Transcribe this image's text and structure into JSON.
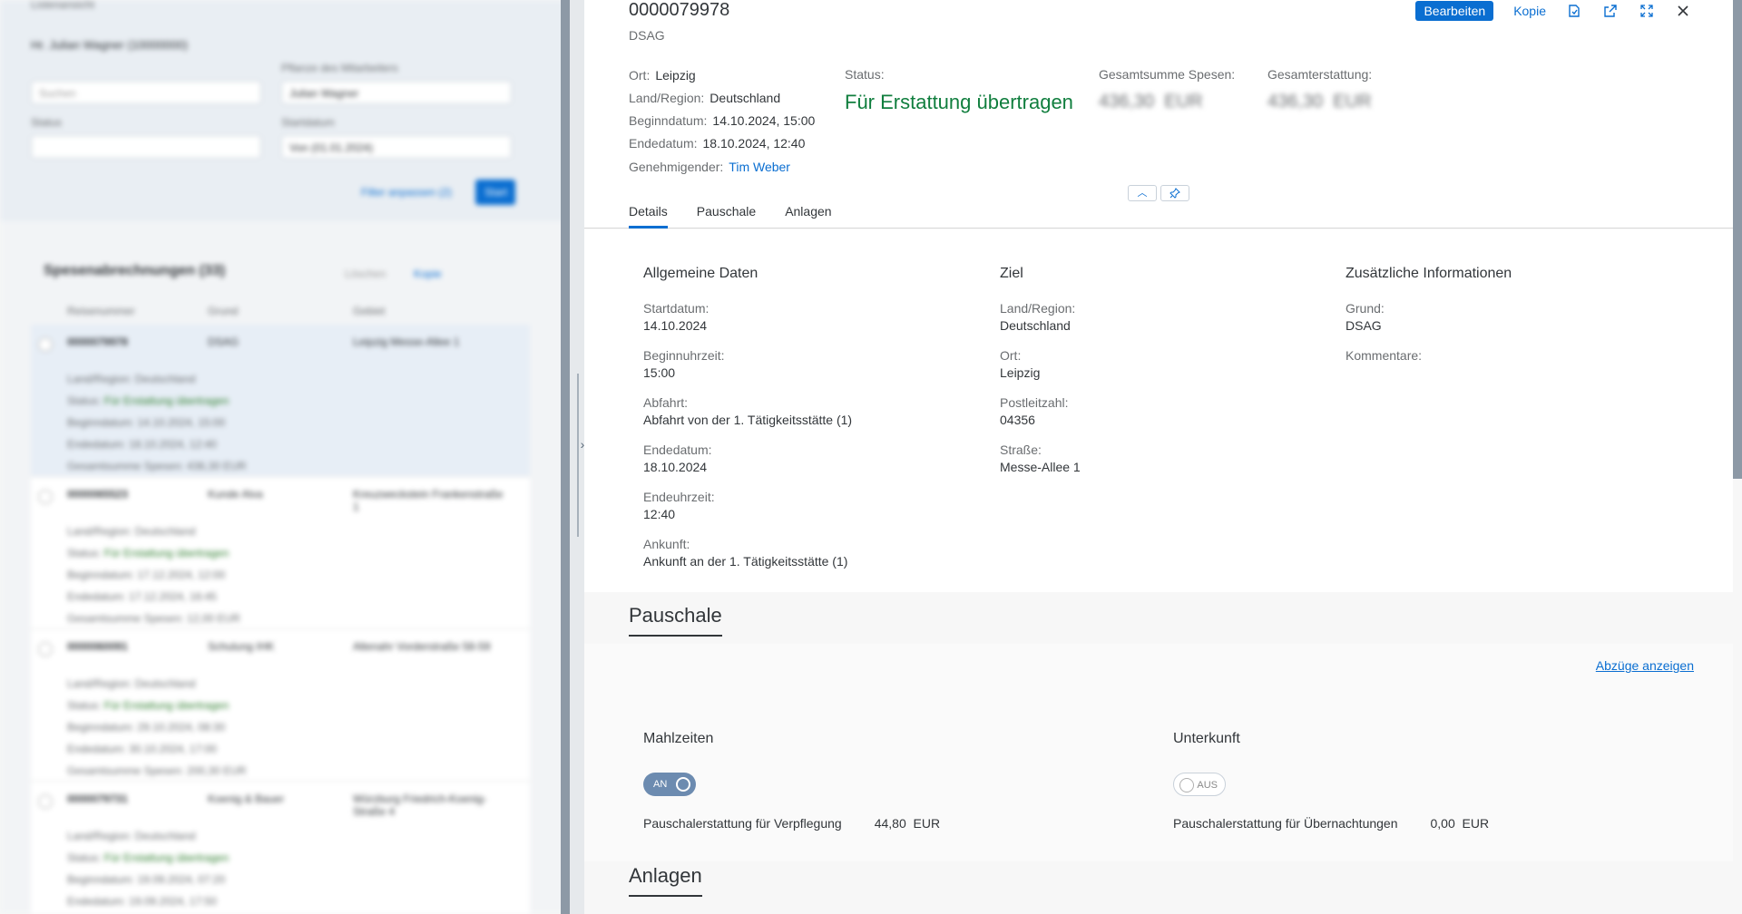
{
  "master": {
    "tag": "Listenansicht",
    "header": "Hr. Julian Wagner (10000000)",
    "search_placeholder": "Suchen",
    "filter1_label": "Pflanze des Mitarbeiters",
    "filter1_value": "Julian Wagner",
    "filter2_label": "Status",
    "filter3_label": "Startdatum",
    "filter3_value": "Von (01.01.2024)",
    "filter_show_btn": "Filter anpassen (2)",
    "go_btn": "Start",
    "list_title": "Spesenabrechnungen (33)",
    "list_action1": "Löschen",
    "list_action2": "Kopie",
    "col_headers": [
      "Reisenummer",
      "Grund",
      "Gebiet"
    ],
    "rows": [
      {
        "id": "0000079978",
        "grund": "DSAG",
        "gebiet": "Leipzig Messe-Allee 1",
        "land": "Land/Region: Deutschland",
        "status_lbl": "Status:",
        "status": "Für Erstattung übertragen",
        "begin": "Beginndatum: 14.10.2024, 15:00",
        "end": "Endedatum: 18.10.2024, 12:40",
        "sum": "Gesamtsumme Spesen: 436,30 EUR"
      },
      {
        "id": "0000065523",
        "grund": "Kunde Alva",
        "gebiet": "Kreuzweckstein Frankenstraße 1",
        "land": "Land/Region: Deutschland",
        "status_lbl": "Status:",
        "status": "Für Erstattung übertragen",
        "begin": "Beginndatum: 17.12.2024, 12:00",
        "end": "Endedatum: 17.12.2024, 16:45",
        "sum": "Gesamtsumme Spesen: 12,00 EUR"
      },
      {
        "id": "0000060091",
        "grund": "Schulung IHK",
        "gebiet": "Altenahr Vorderstraße 58-59",
        "land": "Land/Region: Deutschland",
        "status_lbl": "Status:",
        "status": "Für Erstattung übertragen",
        "begin": "Beginndatum: 29.10.2024, 08:30",
        "end": "Endedatum: 30.10.2024, 17:00",
        "sum": "Gesamtsumme Spesen: 200,30 EUR"
      },
      {
        "id": "0000079731",
        "grund": "Koenig & Bauer",
        "gebiet": "Würzburg Friedrich-Koenig-Straße 4",
        "land": "Land/Region: Deutschland",
        "status_lbl": "Status:",
        "status": "Für Erstattung übertragen",
        "begin": "Beginndatum: 19.09.2024, 07:20",
        "end": "Endedatum: 19.09.2024, 17:50",
        "sum": ""
      }
    ]
  },
  "header": {
    "title": "0000079978",
    "subtitle": "DSAG",
    "ort_lbl": "Ort:",
    "ort": "Leipzig",
    "land_lbl": "Land/Region:",
    "land": "Deutschland",
    "begin_lbl": "Beginndatum:",
    "begin": "14.10.2024, 15:00",
    "end_lbl": "Endedatum:",
    "end": "18.10.2024, 12:40",
    "approver_lbl": "Genehmigender:",
    "approver": "Tim Weber",
    "status_lbl": "Status:",
    "status": "Für Erstattung übertragen",
    "sum_lbl": "Gesamtsumme Spesen:",
    "sum_val": "436,30",
    "sum_cur": "EUR",
    "refund_lbl": "Gesamterstattung:",
    "refund_val": "436,30",
    "refund_cur": "EUR",
    "edit_btn": "Bearbeiten",
    "copy_btn": "Kopie"
  },
  "tabs": [
    "Details",
    "Pauschale",
    "Anlagen"
  ],
  "details": {
    "col1_title": "Allgemeine Daten",
    "col1": [
      {
        "label": "Startdatum:",
        "value": "14.10.2024"
      },
      {
        "label": "Beginnuhrzeit:",
        "value": "15:00"
      },
      {
        "label": "Abfahrt:",
        "value": "Abfahrt von der 1. Tätigkeitsstätte (1)"
      },
      {
        "label": "Endedatum:",
        "value": "18.10.2024"
      },
      {
        "label": "Endeuhrzeit:",
        "value": "12:40"
      },
      {
        "label": "Ankunft:",
        "value": "Ankunft an der 1. Tätigkeitsstätte (1)"
      }
    ],
    "col2_title": "Ziel",
    "col2": [
      {
        "label": "Land/Region:",
        "value": "Deutschland"
      },
      {
        "label": "Ort:",
        "value": "Leipzig"
      },
      {
        "label": "Postleitzahl:",
        "value": "04356"
      },
      {
        "label": "Straße:",
        "value": "Messe-Allee 1"
      }
    ],
    "col3_title": "Zusätzliche Informationen",
    "col3": [
      {
        "label": "Grund:",
        "value": "DSAG"
      },
      {
        "label": "Kommentare:",
        "value": ""
      }
    ]
  },
  "pauschale": {
    "title": "Pauschale",
    "abzuege": "Abzüge anzeigen",
    "meals_title": "Mahlzeiten",
    "meals_toggle": "AN",
    "meals_lbl": "Pauschalerstattung für Verpflegung",
    "meals_val": "44,80",
    "meals_cur": "EUR",
    "stay_title": "Unterkunft",
    "stay_toggle": "AUS",
    "stay_lbl": "Pauschalerstattung für Übernachtungen",
    "stay_val": "0,00",
    "stay_cur": "EUR"
  },
  "anlagen": {
    "title": "Anlagen"
  },
  "colors": {
    "accent": "#0a6ed1",
    "positive": "#107e3e"
  }
}
